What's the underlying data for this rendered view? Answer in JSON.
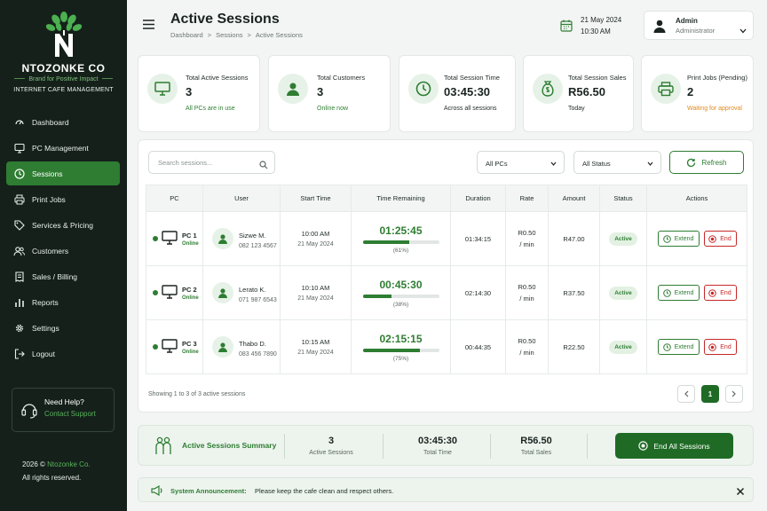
{
  "brand": {
    "name": "NTOZONKE CO",
    "tagline": "Brand for Positive Impact",
    "subtitle": "INTERNET CAFE MANAGEMENT"
  },
  "nav": [
    {
      "label": "Dashboard",
      "icon": "dashboard-icon"
    },
    {
      "label": "PC Management",
      "icon": "monitor-icon"
    },
    {
      "label": "Sessions",
      "icon": "clock-icon",
      "active": true
    },
    {
      "label": "Print Jobs",
      "icon": "printer-icon"
    },
    {
      "label": "Services & Pricing",
      "icon": "tag-icon"
    },
    {
      "label": "Customers",
      "icon": "users-icon"
    },
    {
      "label": "Sales / Billing",
      "icon": "receipt-icon"
    },
    {
      "label": "Reports",
      "icon": "reports-icon"
    },
    {
      "label": "Settings",
      "icon": "gear-icon"
    },
    {
      "label": "Logout",
      "icon": "logout-icon"
    }
  ],
  "help": {
    "title": "Need Help?",
    "link": "Contact Support"
  },
  "copyright": {
    "year": "2026 ©",
    "company": "Ntozonke Co.",
    "rights": "All rights reserved."
  },
  "header": {
    "title": "Active Sessions",
    "breadcrumb": [
      "Dashboard",
      ">",
      "Sessions",
      ">",
      "Active Sessions"
    ],
    "date": "21 May 2024",
    "time": "10:30 AM",
    "user_name": "Admin",
    "user_role": "Administrator"
  },
  "stats": [
    {
      "label": "Total Active Sessions",
      "value": "3",
      "sub": "All PCs are in use",
      "sub_color": "#2e7d32",
      "icon": "monitor-icon"
    },
    {
      "label": "Total Customers",
      "value": "3",
      "sub": "Online now",
      "sub_color": "#2e7d32",
      "icon": "user-icon"
    },
    {
      "label": "Total Session Time",
      "value": "03:45:30",
      "sub": "Across all sessions",
      "sub_color": "#1e2a24",
      "icon": "clock-icon"
    },
    {
      "label": "Total Session Sales",
      "value": "R56.50",
      "sub": "Today",
      "sub_color": "#1e2a24",
      "icon": "money-bag-icon"
    },
    {
      "label": "Print Jobs (Pending)",
      "value": "2",
      "sub": "Waiting for approval",
      "sub_color": "#e08a1e",
      "icon": "printer-icon"
    }
  ],
  "filters": {
    "search_placeholder": "Search sessions...",
    "pc_filter": "All PCs",
    "status_filter": "All Status",
    "refresh": "Refresh"
  },
  "table": {
    "headers": [
      "PC",
      "User",
      "Start Time",
      "Time Remaining",
      "Duration",
      "Rate",
      "Amount",
      "Status",
      "Actions"
    ],
    "rows": [
      {
        "pc": "PC 1",
        "pc_status": "Online",
        "user": "Sizwe M.",
        "phone": "082 123 4567",
        "start": "10:00 AM",
        "date": "21 May 2024",
        "remaining": "01:25:45",
        "pct_label": "(61%)",
        "pct": 61,
        "duration": "01:34:15",
        "rate": "R0.50",
        "rate_unit": "/ min",
        "amount": "R47.00",
        "status": "Active"
      },
      {
        "pc": "PC 2",
        "pc_status": "Online",
        "user": "Lerato K.",
        "phone": "071 987 6543",
        "start": "10:10 AM",
        "date": "21 May 2024",
        "remaining": "00:45:30",
        "pct_label": "(38%)",
        "pct": 38,
        "duration": "02:14:30",
        "rate": "R0.50",
        "rate_unit": "/ min",
        "amount": "R37.50",
        "status": "Active"
      },
      {
        "pc": "PC 3",
        "pc_status": "Online",
        "user": "Thabo D.",
        "phone": "083 456 7890",
        "start": "10:15 AM",
        "date": "21 May 2024",
        "remaining": "02:15:15",
        "pct_label": "(75%)",
        "pct": 75,
        "duration": "00:44:35",
        "rate": "R0.50",
        "rate_unit": "/ min",
        "amount": "R22.50",
        "status": "Active"
      }
    ],
    "extend_label": "Extend",
    "end_label": "End",
    "showing": "Showing 1 to 3 of 3 active sessions",
    "page": "1"
  },
  "summary": {
    "title": "Active Sessions Summary",
    "sessions_value": "3",
    "sessions_label": "Active Sessions",
    "time_value": "03:45:30",
    "time_label": "Total Time",
    "sales_value": "R56.50",
    "sales_label": "Total Sales",
    "end_all": "End All Sessions"
  },
  "announcement": {
    "title": "System Announcement:",
    "message": "Please keep the cafe clean and respect others."
  },
  "colors": {
    "accent": "#2e7d32",
    "sidebar": "#15201b",
    "danger": "#c62828",
    "warning": "#e08a1e"
  }
}
